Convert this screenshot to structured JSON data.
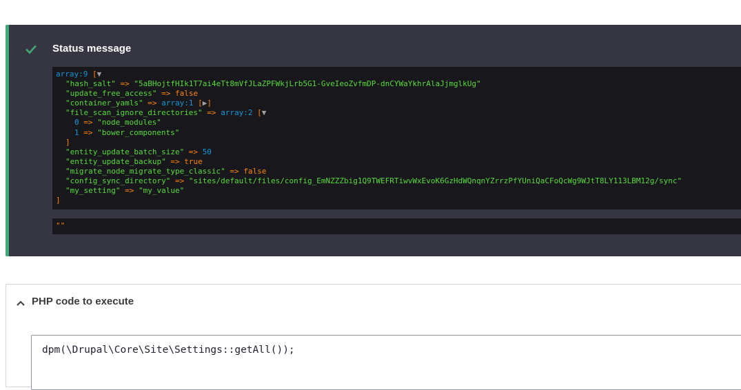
{
  "status": {
    "title": "Status message",
    "icon": "check-icon",
    "accent_color": "#42a877",
    "dump": {
      "header": {
        "type": "array:9",
        "open": " [",
        "toggle": "▼"
      },
      "lines": [
        {
          "key": "\"hash_salt\"",
          "arrow": " => ",
          "value": "\"5aBHojtfHIk1T7ai4eTt8mVfJLaZPFWkjLrb5G1-GveIeoZvfmDP-dnCYWaYkhrAlaJjmglkUg\"",
          "vtype": "str",
          "indent": 1
        },
        {
          "key": "\"update_free_access\"",
          "arrow": " => ",
          "value": "false",
          "vtype": "const",
          "indent": 1
        },
        {
          "key": "\"container_yamls\"",
          "arrow": " => ",
          "value": "array:1",
          "vtype": "type",
          "suffix": " [",
          "toggle": "▶",
          "close": "]",
          "indent": 1
        },
        {
          "key": "\"file_scan_ignore_directories\"",
          "arrow": " => ",
          "value": "array:2",
          "vtype": "type",
          "suffix": " [",
          "toggle": "▼",
          "indent": 1
        },
        {
          "key": "0",
          "arrow": " => ",
          "value": "\"node_modules\"",
          "vtype": "str",
          "indent": 2,
          "numkey": true
        },
        {
          "key": "1",
          "arrow": " => ",
          "value": "\"bower_components\"",
          "vtype": "str",
          "indent": 2,
          "numkey": true
        },
        {
          "plain": "]",
          "indent": 1
        },
        {
          "key": "\"entity_update_batch_size\"",
          "arrow": " => ",
          "value": "50",
          "vtype": "num",
          "indent": 1
        },
        {
          "key": "\"entity_update_backup\"",
          "arrow": " => ",
          "value": "true",
          "vtype": "const",
          "indent": 1
        },
        {
          "key": "\"migrate_node_migrate_type_classic\"",
          "arrow": " => ",
          "value": "false",
          "vtype": "const",
          "indent": 1
        },
        {
          "key": "\"config_sync_directory\"",
          "arrow": " => ",
          "value": "\"sites/default/files/config_EmNZZZbig1Q9TWEFRTiwvWxEvoK6GzHdWQnqnYZrrzPfYUniQaCFoQcWg9WJtT8LY113LBM12g/sync\"",
          "vtype": "str",
          "indent": 1
        },
        {
          "key": "\"my_setting\"",
          "arrow": " => ",
          "value": "\"my_value\"",
          "vtype": "str",
          "indent": 1
        },
        {
          "plain": "]",
          "indent": 0
        }
      ]
    },
    "second_dump": "\"\""
  },
  "php_section": {
    "label": "PHP code to execute",
    "icon": "chevron-up-icon",
    "code": "dpm(\\Drupal\\Core\\Site\\Settings::getAll());"
  }
}
